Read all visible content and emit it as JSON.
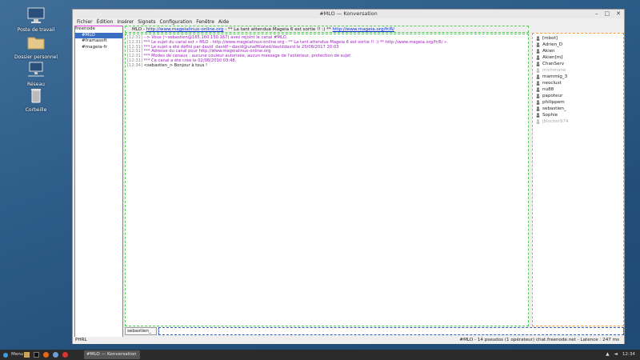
{
  "desktop": {
    "icons": [
      {
        "label": "Poste de travail",
        "icon": "computer-icon"
      },
      {
        "label": "Dossier personnel",
        "icon": "folder-icon"
      },
      {
        "label": "Réseau",
        "icon": "network-icon"
      },
      {
        "label": "Corbeille",
        "icon": "trash-icon"
      }
    ]
  },
  "window": {
    "title": "#MLO — Konversation",
    "menu": [
      "Fichier",
      "Édition",
      "Insérer",
      "Signets",
      "Configuration",
      "Fenêtre",
      "Aide"
    ],
    "tree": {
      "server": "freenode",
      "channels": [
        "#MLO",
        "#framasoft",
        "#mageia-fr"
      ]
    },
    "topic": {
      "prefix": "MLO - ",
      "link1": "http://www.mageialinux-online.org",
      "middle": " - ** La tant attendue Mageia 6 est sortie !! :) ** ",
      "link2": "http://www.mageia.org/fr/6/"
    },
    "messages": [
      {
        "ts": "[12:31]",
        "text": "--> Vous (~sebastien@165.160.150.167) avez rejoint le canal #MLO.",
        "style": "purple"
      },
      {
        "ts": "[12:31]",
        "text": "*** Le sujet du canal est « MLO - http://www.mageialinux-online.org - ** La tant attendue Mageia 6 est sortie !! :) ** http://www.mageia.org/fr/6/ ».",
        "style": "purple"
      },
      {
        "ts": "[12:31]",
        "text": "*** Le sujet a été défini par david_david!~david@unaffiliated/daviddavid le 25/08/2017 20:03",
        "style": "purple"
      },
      {
        "ts": "[12:31]",
        "text": "*** Adresse du canal pour http://www.mageialinux-online.org",
        "style": "purple"
      },
      {
        "ts": "[12:31]",
        "text": "*** Modes de canaux : aucune couleur autorisée, aucun message de l'extérieur, protection de sujet",
        "style": "purple"
      },
      {
        "ts": "[12:31]",
        "text": "*** Ce canal a été créé le 02/08/2010 03:48.",
        "style": "purple"
      },
      {
        "ts": "[12:34]",
        "text": "<sebastien_> Bonjour à tous !",
        "style": "normal"
      }
    ],
    "nicklist": [
      {
        "name": "[mbot]",
        "away": false
      },
      {
        "name": "Adrien_D",
        "away": false
      },
      {
        "name": "Akien",
        "away": false
      },
      {
        "name": "Akien[m]",
        "away": false
      },
      {
        "name": "ChanServ",
        "away": false
      },
      {
        "name": "mlchmane",
        "away": true
      },
      {
        "name": "mammig_3",
        "away": false
      },
      {
        "name": "neoclust",
        "away": false
      },
      {
        "name": "nu88",
        "away": false
      },
      {
        "name": "papoteur",
        "away": false
      },
      {
        "name": "philippem",
        "away": false
      },
      {
        "name": "sebastien_",
        "away": false
      },
      {
        "name": "Sophie",
        "away": false
      },
      {
        "name": "jblocker974",
        "away": true
      }
    ],
    "input": {
      "nick": "sebastien_",
      "value": ""
    },
    "status": {
      "left": "PHRL",
      "right": "#MLO - 14 pseudos (1 opérateur)  chat.freenode.net - Latence : 247 ms"
    }
  },
  "taskbar": {
    "menu_label": "Menu",
    "task": "#MLO — Konversation",
    "clock": "12:34"
  },
  "colors": {
    "tree_border": "#e040e0",
    "chat_border": "#55cc55",
    "nick_border": "#ff9933",
    "input_border": "#3060c0",
    "system_text": "#a020c0",
    "link": "#1030d0"
  }
}
